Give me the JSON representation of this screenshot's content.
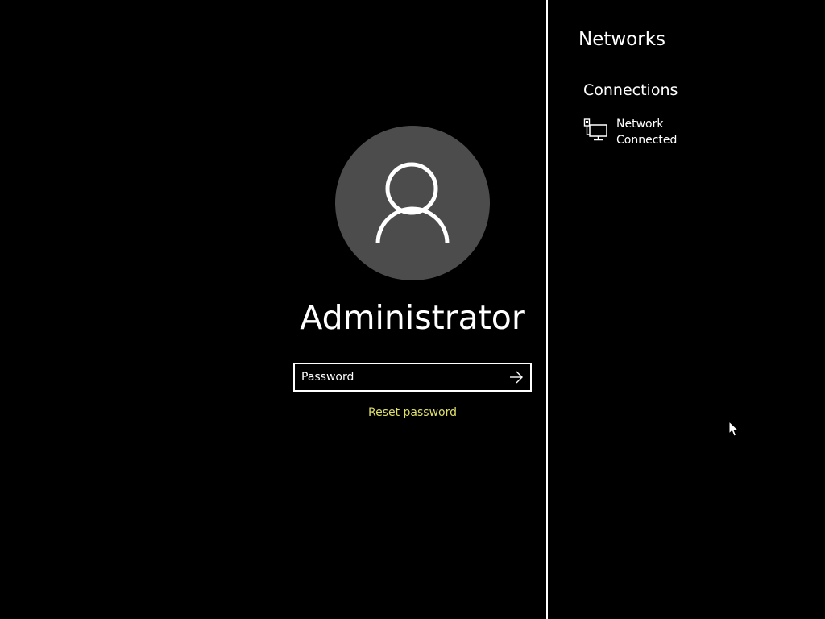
{
  "login": {
    "username": "Administrator",
    "password_placeholder": "Password",
    "password_value": "",
    "reset_password_label": "Reset password",
    "avatar_icon": "user-silhouette-icon",
    "submit_icon": "arrow-right-icon"
  },
  "networks_pane": {
    "title": "Networks",
    "section_heading": "Connections",
    "connections": [
      {
        "name": "Network",
        "status": "Connected",
        "icon": "wired-network-icon"
      }
    ]
  },
  "colors": {
    "background": "#000000",
    "avatar_background": "#4c4c4c",
    "foreground": "#ffffff",
    "link": "#dede6a"
  }
}
